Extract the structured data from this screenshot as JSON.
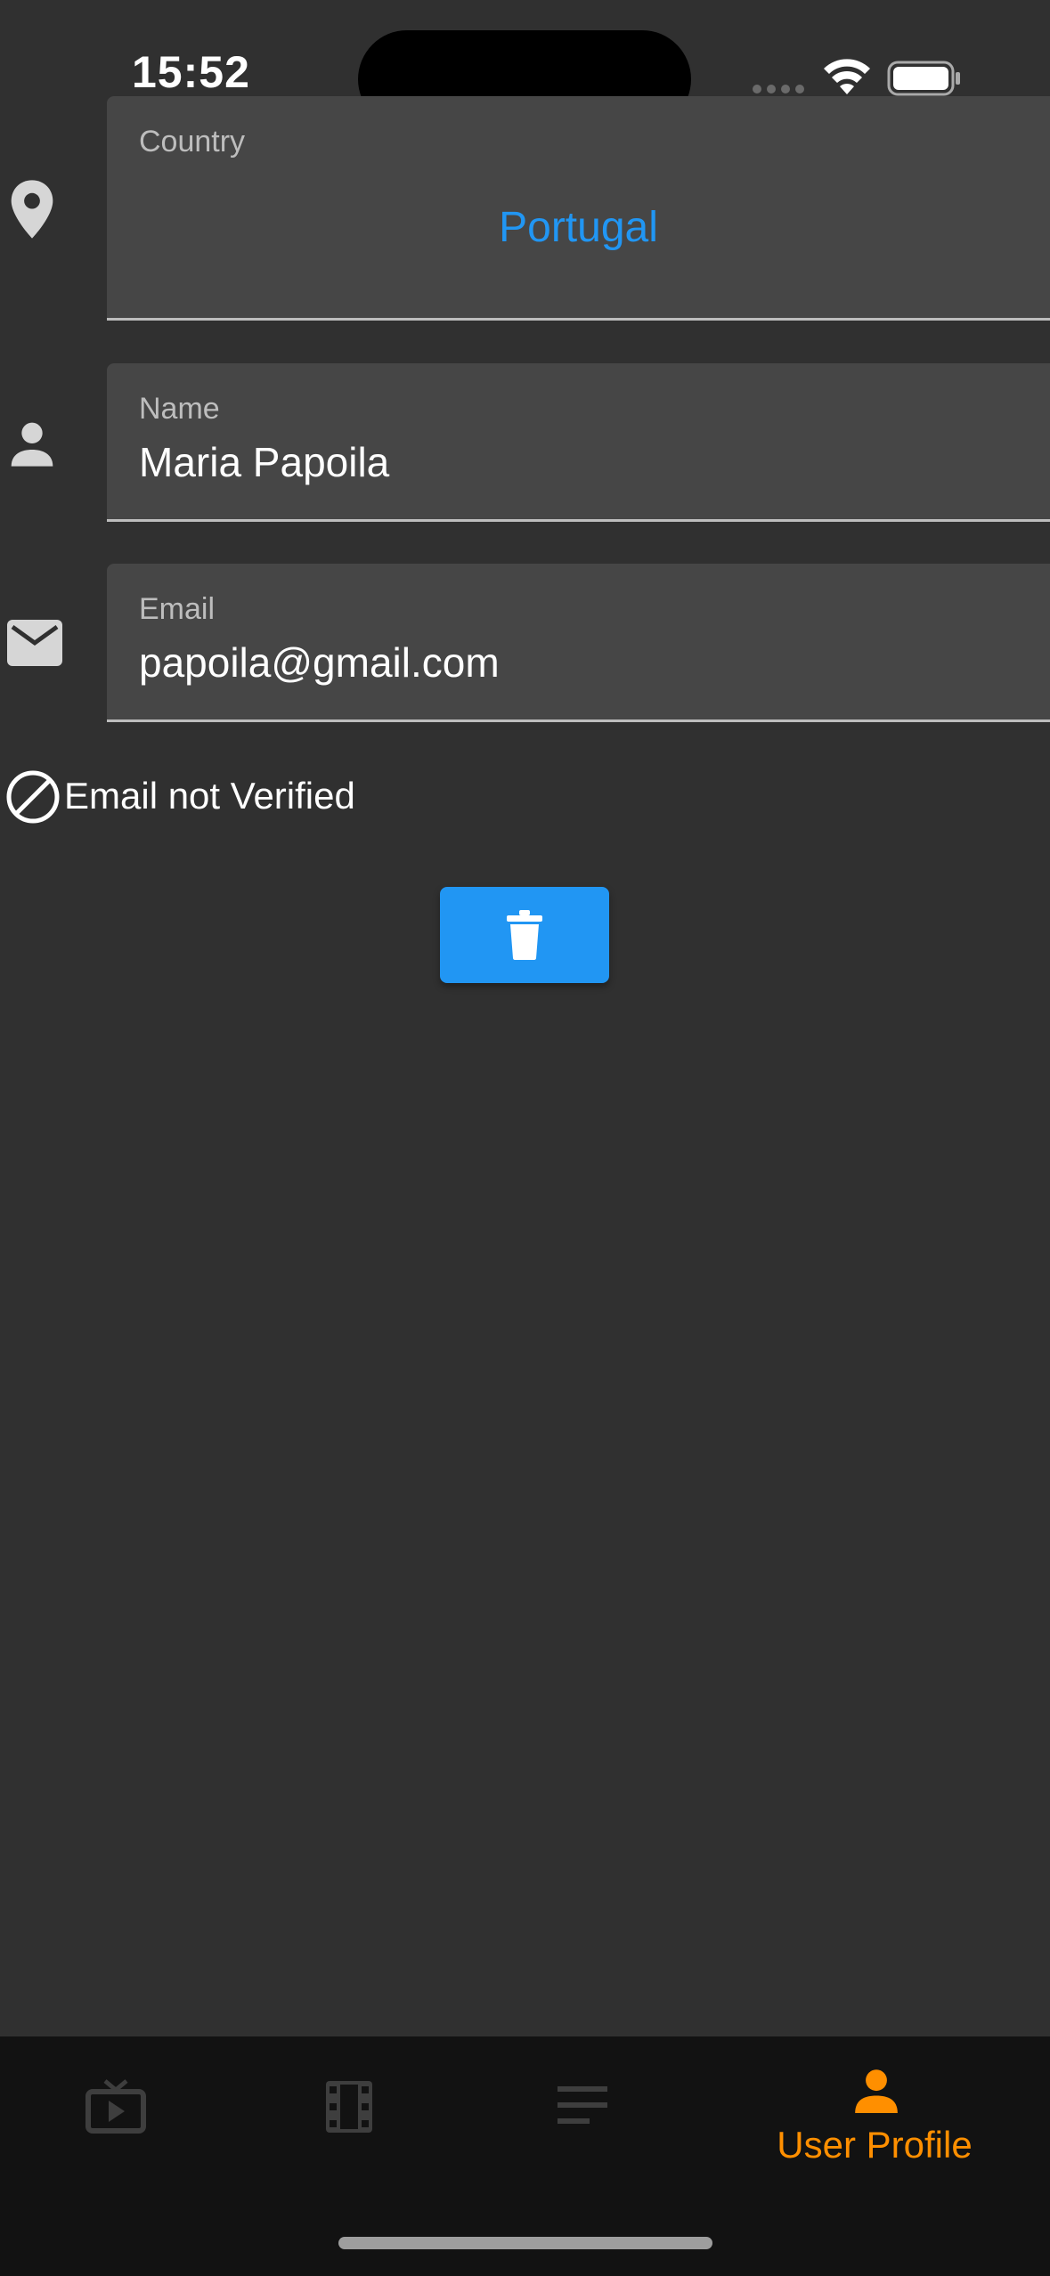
{
  "status_bar": {
    "time": "15:52"
  },
  "fields": {
    "country": {
      "label": "Country",
      "value": "Portugal",
      "icon": "location-pin-icon"
    },
    "name": {
      "label": "Name",
      "value": "Maria Papoila",
      "icon": "person-icon"
    },
    "email": {
      "label": "Email",
      "value": "papoila@gmail.com",
      "icon": "mail-icon"
    }
  },
  "verification": {
    "text": "Email not Verified",
    "icon": "block-icon"
  },
  "delete_button": {
    "icon": "trash-icon"
  },
  "bottom_nav": {
    "items": [
      {
        "icon": "tv-icon",
        "label": ""
      },
      {
        "icon": "film-icon",
        "label": ""
      },
      {
        "icon": "list-icon",
        "label": ""
      },
      {
        "icon": "user-profile-icon",
        "label": "User Profile"
      }
    ],
    "active_index": 3
  },
  "colors": {
    "background": "#303030",
    "field_background": "#464646",
    "accent_blue": "#2196f3",
    "active_orange": "#ff8f00",
    "inactive_icon": "#3e3e3e",
    "nav_background": "#121212"
  }
}
